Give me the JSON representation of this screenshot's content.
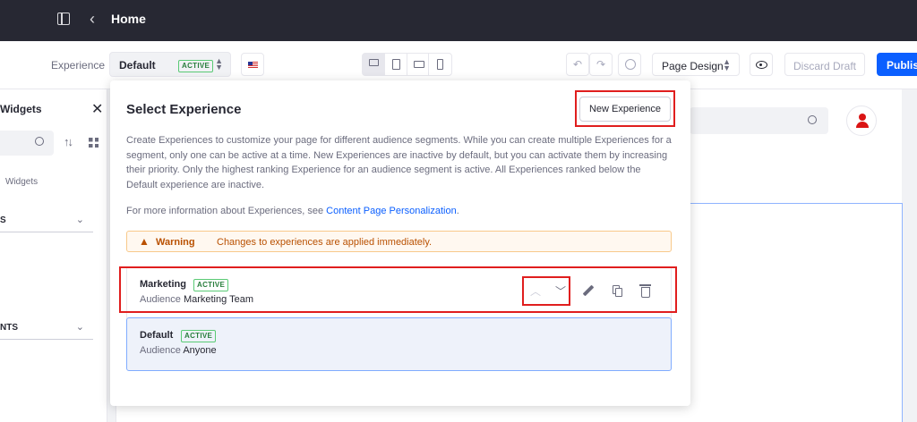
{
  "topbar": {
    "title": "Home"
  },
  "toolbar": {
    "experience_label": "Experience",
    "experience_selected": "Default",
    "experience_selected_badge": "ACTIVE",
    "undo_glyph": "↶",
    "redo_glyph": "↷",
    "page_design_label": "Page Design",
    "discard_label": "Discard Draft",
    "publish_label": "Publish"
  },
  "widgets_panel": {
    "title": "Widgets",
    "close_glyph": "✕",
    "sort_glyph": "↑↓",
    "tab_label": "Widgets",
    "sections": [
      "S",
      "NTS"
    ]
  },
  "modal": {
    "title": "Select Experience",
    "new_experience_label": "New Experience",
    "description": "Create Experiences to customize your page for different audience segments. While you can create multiple Experiences for a segment, only one can be active at a time. New Experiences are inactive by default, but you can activate them by increasing their priority. Only the highest ranking Experience for an audience segment is active. All Experiences ranked below the Default experience are inactive.",
    "more_info_prefix": "For more information about Experiences, see ",
    "more_info_link": "Content Page Personalization",
    "more_info_suffix": ".",
    "warning_title": "Warning",
    "warning_text": "Changes to experiences are applied immediately.",
    "audience_label": "Audience",
    "experiences": [
      {
        "name": "Marketing",
        "badge": "ACTIVE",
        "audience": "Marketing Team"
      },
      {
        "name": "Default",
        "badge": "ACTIVE",
        "audience": "Anyone"
      }
    ]
  },
  "colors": {
    "topbar": "#272833",
    "primary": "#0b5fff",
    "active_badge": "#287d3c",
    "warning": "#b95000",
    "annotation_highlight": "#e01e1e"
  },
  "icons": [
    "sidebar-toggle-icon",
    "back-chevron-icon",
    "kebab-icon",
    "us-flag-icon",
    "desktop-icon",
    "tablet-icon",
    "landscape-phone-icon",
    "phone-icon",
    "undo-icon",
    "redo-icon",
    "history-icon",
    "eye-icon",
    "search-icon",
    "sort-icon",
    "grid-icon",
    "close-icon",
    "warning-icon",
    "chevron-up-icon",
    "chevron-down-icon",
    "pencil-icon",
    "copy-icon",
    "trash-icon",
    "user-avatar-icon"
  ]
}
